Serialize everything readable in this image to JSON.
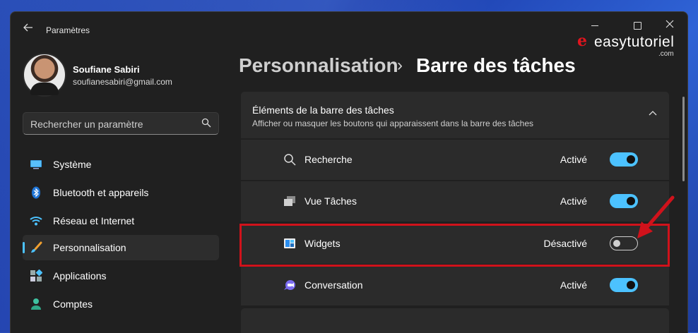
{
  "window": {
    "title": "Paramètres"
  },
  "logo": {
    "mark": "e",
    "text": "easytutoriel",
    "sub": ".com"
  },
  "user": {
    "name": "Soufiane Sabiri",
    "email": "soufianesabiri@gmail.com"
  },
  "search": {
    "placeholder": "Rechercher un paramètre"
  },
  "sidebar": {
    "items": [
      {
        "label": "Système",
        "icon": "monitor-icon",
        "active": false
      },
      {
        "label": "Bluetooth et appareils",
        "icon": "bluetooth-icon",
        "active": false
      },
      {
        "label": "Réseau et Internet",
        "icon": "wifi-icon",
        "active": false
      },
      {
        "label": "Personnalisation",
        "icon": "brush-icon",
        "active": true
      },
      {
        "label": "Applications",
        "icon": "apps-icon",
        "active": false
      },
      {
        "label": "Comptes",
        "icon": "person-icon",
        "active": false
      }
    ]
  },
  "breadcrumb": {
    "parent": "Personnalisation",
    "separator": "›",
    "current": "Barre des tâches"
  },
  "section": {
    "title": "Éléments de la barre des tâches",
    "subtitle": "Afficher ou masquer les boutons qui apparaissent dans la barre des tâches",
    "rows": [
      {
        "label": "Recherche",
        "state": "Activé",
        "on": true,
        "icon": "search-icon"
      },
      {
        "label": "Vue Tâches",
        "state": "Activé",
        "on": true,
        "icon": "task-view-icon"
      },
      {
        "label": "Widgets",
        "state": "Désactivé",
        "on": false,
        "icon": "widgets-icon"
      },
      {
        "label": "Conversation",
        "state": "Activé",
        "on": true,
        "icon": "chat-icon"
      }
    ]
  },
  "colors": {
    "accent": "#4cc2ff",
    "highlight": "#d0121b",
    "window_bg": "#202020",
    "card_bg": "#2b2b2b"
  }
}
